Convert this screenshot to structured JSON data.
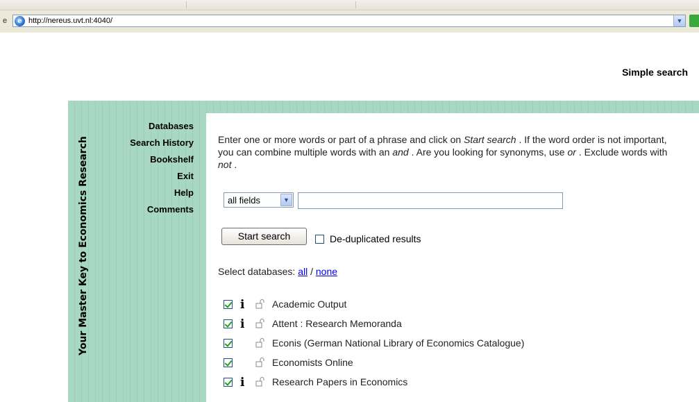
{
  "browser": {
    "address_prefix": "e",
    "url": "http://nereus.uvt.nl:4040/"
  },
  "page": {
    "heading": "Simple search",
    "tagline": "Your Master Key to Economics Research"
  },
  "nav": {
    "items": [
      {
        "label": "Databases"
      },
      {
        "label": "Search History"
      },
      {
        "label": "Bookshelf"
      },
      {
        "label": "Exit"
      },
      {
        "label": "Help"
      },
      {
        "label": "Comments"
      }
    ]
  },
  "search": {
    "instructions": {
      "p1": "Enter one or more words or part of a phrase and click on ",
      "em1": "Start search",
      "p2": " . If the word order is not important, you can combine multiple words with an ",
      "em2": "and",
      "p3": " . Are you looking for synonyms, use ",
      "em3": "or",
      "p4": " . Exclude words with ",
      "em4": "not",
      "p5": " ."
    },
    "field_selected": "all fields",
    "query_value": "",
    "start_label": "Start search",
    "dedup_label": "De-duplicated results",
    "dedup_checked": false
  },
  "databases": {
    "select_label": "Select databases: ",
    "all_label": "all",
    "separator": " / ",
    "none_label": "none",
    "items": [
      {
        "name": "Academic Output",
        "checked": true,
        "info": true
      },
      {
        "name": "Attent : Research Memoranda",
        "checked": true,
        "info": true
      },
      {
        "name": "Econis (German National Library of Economics Catalogue)",
        "checked": true,
        "info": false
      },
      {
        "name": "Economists Online",
        "checked": true,
        "info": false
      },
      {
        "name": "Research Papers in Economics",
        "checked": true,
        "info": true
      }
    ]
  },
  "colors": {
    "panel_green": "#a8d8c3",
    "link_blue": "#0000ee",
    "check_green": "#21a121"
  },
  "icons": {
    "browser_page": "ie-page-icon",
    "info": "info-icon",
    "access": "unlock-icon"
  }
}
